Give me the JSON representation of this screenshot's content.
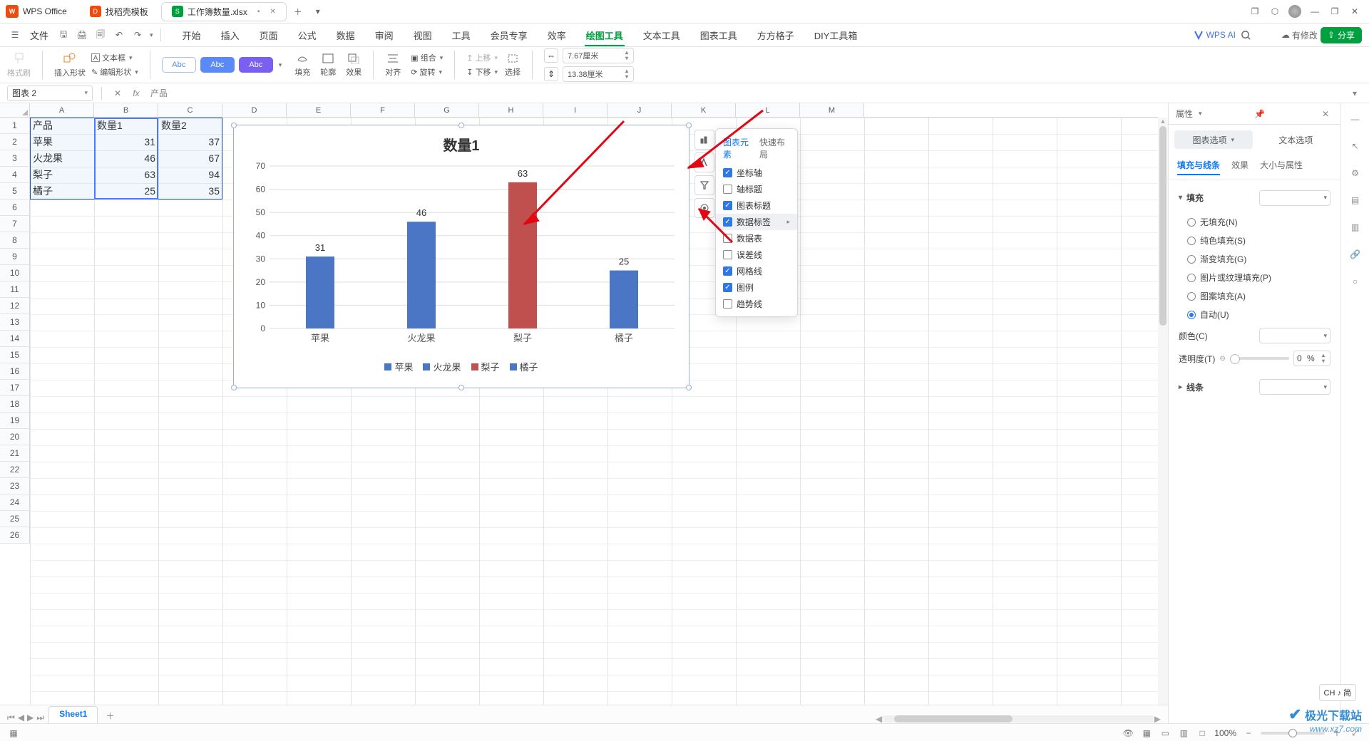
{
  "app": {
    "name": "WPS Office"
  },
  "tabs": [
    {
      "name": "找稻壳模板",
      "icon_bg": "#e94d0f"
    },
    {
      "name": "工作簿数量.xlsx",
      "icon_bg": "#00a03e",
      "modified": "•"
    }
  ],
  "window_controls": {
    "min": "—",
    "max": "❐",
    "close": "✕"
  },
  "file_menu": "文件",
  "qat": [
    "保存",
    "打印",
    "打印预览",
    "撤销",
    "重做"
  ],
  "menus": [
    "开始",
    "插入",
    "页面",
    "公式",
    "数据",
    "审阅",
    "视图",
    "工具",
    "会员专享",
    "效率",
    "绘图工具",
    "文本工具",
    "图表工具",
    "方方格子",
    "DIY工具箱"
  ],
  "menu_active": "绘图工具",
  "ai_label": "WPS AI",
  "modify_label": "有修改",
  "share": "分享",
  "ribbon": {
    "format_painter": "格式刷",
    "insert_shape": "插入形状",
    "edit_shape": "编辑形状",
    "text_box": "文本框",
    "style_pill": "Abc",
    "fill": "填充",
    "outline": "轮廓",
    "effect": "效果",
    "align": "对齐",
    "group": "组合",
    "rotate": "旋转",
    "group2": "组合",
    "up": "上移",
    "down": "下移",
    "select": "选择",
    "width": "7.67厘米",
    "height": "13.38厘米"
  },
  "fx": {
    "name": "图表 2",
    "value": "产品"
  },
  "columns": [
    "A",
    "B",
    "C",
    "D",
    "E",
    "F",
    "G",
    "H",
    "I",
    "J",
    "K",
    "L",
    "M"
  ],
  "rows": 26,
  "cells": {
    "A1": "产品",
    "B1": "数量1",
    "C1": "数量2",
    "A2": "苹果",
    "B2": "31",
    "C2": "37",
    "A3": "火龙果",
    "B3": "46",
    "C3": "67",
    "A4": "梨子",
    "B4": "63",
    "C4": "94",
    "A5": "橘子",
    "B5": "25",
    "C5": "35"
  },
  "chart_data": {
    "type": "bar",
    "title": "数量1",
    "categories": [
      "苹果",
      "火龙果",
      "梨子",
      "橘子"
    ],
    "values": [
      31,
      46,
      63,
      25
    ],
    "colors": [
      "#4a76c5",
      "#4a76c5",
      "#c0504d",
      "#4a76c5"
    ],
    "legend": [
      "苹果",
      "火龙果",
      "梨子",
      "橘子"
    ],
    "legend_colors": [
      "#4a76c5",
      "#4a76c5",
      "#c0504d",
      "#4a76c5"
    ],
    "ylim": [
      0,
      70
    ],
    "ystep": 10,
    "xlabel": "",
    "ylabel": ""
  },
  "chart_popup": {
    "tabs": [
      "图表元素",
      "快速布局"
    ],
    "active_tab": "图表元素",
    "items": [
      {
        "label": "坐标轴",
        "checked": true
      },
      {
        "label": "轴标题",
        "checked": false
      },
      {
        "label": "图表标题",
        "checked": true
      },
      {
        "label": "数据标签",
        "checked": true,
        "hl": true,
        "arrow": true
      },
      {
        "label": "数据表",
        "checked": false
      },
      {
        "label": "误差线",
        "checked": false
      },
      {
        "label": "网格线",
        "checked": true
      },
      {
        "label": "图例",
        "checked": true
      },
      {
        "label": "趋势线",
        "checked": false
      }
    ]
  },
  "panel": {
    "title": "属性",
    "tabs": [
      "图表选项",
      "文本选项"
    ],
    "active_tab": "图表选项",
    "subtabs": [
      "填充与线条",
      "效果",
      "大小与属性"
    ],
    "active_sub": "填充与线条",
    "section1": "填充",
    "fill_opts": [
      "无填充(N)",
      "纯色填充(S)",
      "渐变填充(G)",
      "图片或纹理填充(P)",
      "图案填充(A)",
      "自动(U)"
    ],
    "fill_sel": "自动(U)",
    "color_label": "颜色(C)",
    "trans_label": "透明度(T)",
    "trans_val": "0",
    "trans_unit": "%",
    "section2": "线条"
  },
  "sidebar_icons": [
    "select-icon",
    "style-icon",
    "properties-icon",
    "filter-icon",
    "settings-icon",
    "link-icon"
  ],
  "sheet_tabs": [
    "Sheet1"
  ],
  "sheetbar_nav": [
    "⏮",
    "◀",
    "▶",
    "⏭"
  ],
  "status": {
    "zoom": "100%",
    "ime": "CH ♪ 简"
  },
  "watermark": {
    "big": "极光下载站",
    "small": "www.xz7.com"
  }
}
